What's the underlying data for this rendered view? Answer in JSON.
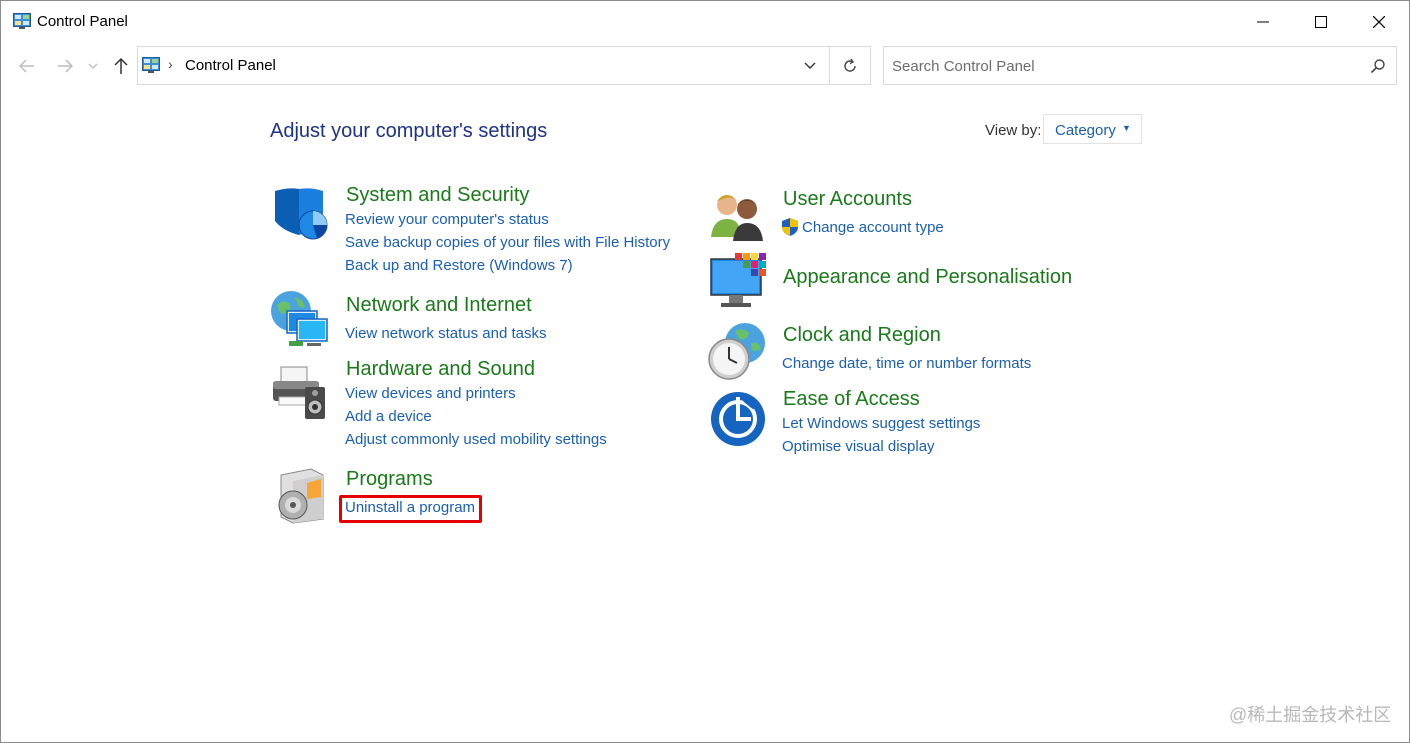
{
  "window": {
    "title": "Control Panel",
    "minimize_icon": "minimize-icon",
    "maximize_icon": "maximize-icon",
    "close_icon": "close-icon"
  },
  "address": {
    "breadcrumb": "Control Panel",
    "separator": "›"
  },
  "search": {
    "placeholder": "Search Control Panel",
    "value": ""
  },
  "content": {
    "title": "Adjust your computer's settings",
    "view_by_label": "View by:",
    "view_by_value": "Category"
  },
  "categories": {
    "system_security": {
      "title": "System and Security",
      "icon": "shield-icon",
      "links": [
        "Review your computer's status",
        "Save backup copies of your files with File History",
        "Back up and Restore (Windows 7)"
      ]
    },
    "network": {
      "title": "Network and Internet",
      "icon": "network-globe-icon",
      "links": [
        "View network status and tasks"
      ]
    },
    "hardware": {
      "title": "Hardware and Sound",
      "icon": "printer-speaker-icon",
      "links": [
        "View devices and printers",
        "Add a device",
        "Adjust commonly used mobility settings"
      ]
    },
    "programs": {
      "title": "Programs",
      "icon": "programs-disc-icon",
      "links": [
        "Uninstall a program"
      ]
    },
    "user_accounts": {
      "title": "User Accounts",
      "icon": "users-icon",
      "links": [
        "Change account type"
      ]
    },
    "appearance": {
      "title": "Appearance and Personalisation",
      "icon": "monitor-palette-icon",
      "links": []
    },
    "clock_region": {
      "title": "Clock and Region",
      "icon": "clock-globe-icon",
      "links": [
        "Change date, time or number formats"
      ]
    },
    "ease_access": {
      "title": "Ease of Access",
      "icon": "ease-of-access-icon",
      "links": [
        "Let Windows suggest settings",
        "Optimise visual display"
      ]
    }
  },
  "colors": {
    "category_title": "#1a7a1a",
    "link": "#1a5fb4",
    "page_title": "#1e3287",
    "highlight": "#e60000"
  },
  "watermark": "@稀土掘金技术社区"
}
